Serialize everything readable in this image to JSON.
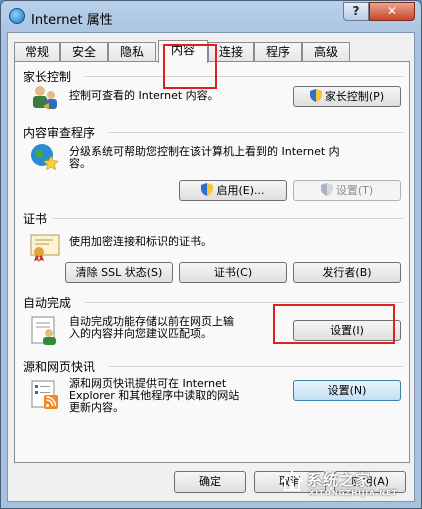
{
  "window": {
    "title": "Internet 属性",
    "help_label": "?",
    "close_label": "✕"
  },
  "tabs": [
    {
      "label": "常规"
    },
    {
      "label": "安全"
    },
    {
      "label": "隐私"
    },
    {
      "label": "内容"
    },
    {
      "label": "连接"
    },
    {
      "label": "程序"
    },
    {
      "label": "高级"
    }
  ],
  "active_tab": "内容",
  "parental": {
    "title": "家长控制",
    "desc": "控制可查看的 Internet 内容。",
    "button": "家长控制(P)",
    "icon": "parental-control-icon"
  },
  "advisor": {
    "title": "内容审查程序",
    "desc_line1": "分级系统可帮助您控制在该计算机上看到的 Internet 内",
    "desc_line2": "容。",
    "enable_button": "启用(E)...",
    "settings_button": "设置(T)",
    "icon": "content-advisor-icon"
  },
  "certificates": {
    "title": "证书",
    "desc": "使用加密连接和标识的证书。",
    "clear_ssl_button": "清除 SSL 状态(S)",
    "certificates_button": "证书(C)",
    "publishers_button": "发行者(B)",
    "icon": "certificate-icon"
  },
  "autocomplete": {
    "title": "自动完成",
    "desc_line1": "自动完成功能存储以前在网页上输",
    "desc_line2": "入的内容并向您建议匹配项。",
    "settings_button": "设置(I)",
    "icon": "autocomplete-icon"
  },
  "feeds": {
    "title": "源和网页快讯",
    "desc_line1": "源和网页快讯提供可在 Internet",
    "desc_line2": "Explorer 和其他程序中读取的网站",
    "desc_line3": "更新内容。",
    "settings_button": "设置(N)",
    "icon": "feeds-icon"
  },
  "footer": {
    "ok_button": "确定",
    "cancel_button": "取消",
    "apply_button": "应用(A)"
  },
  "watermark": {
    "text": "系统之家",
    "sub": "XITONGZHIJIA.NET"
  }
}
